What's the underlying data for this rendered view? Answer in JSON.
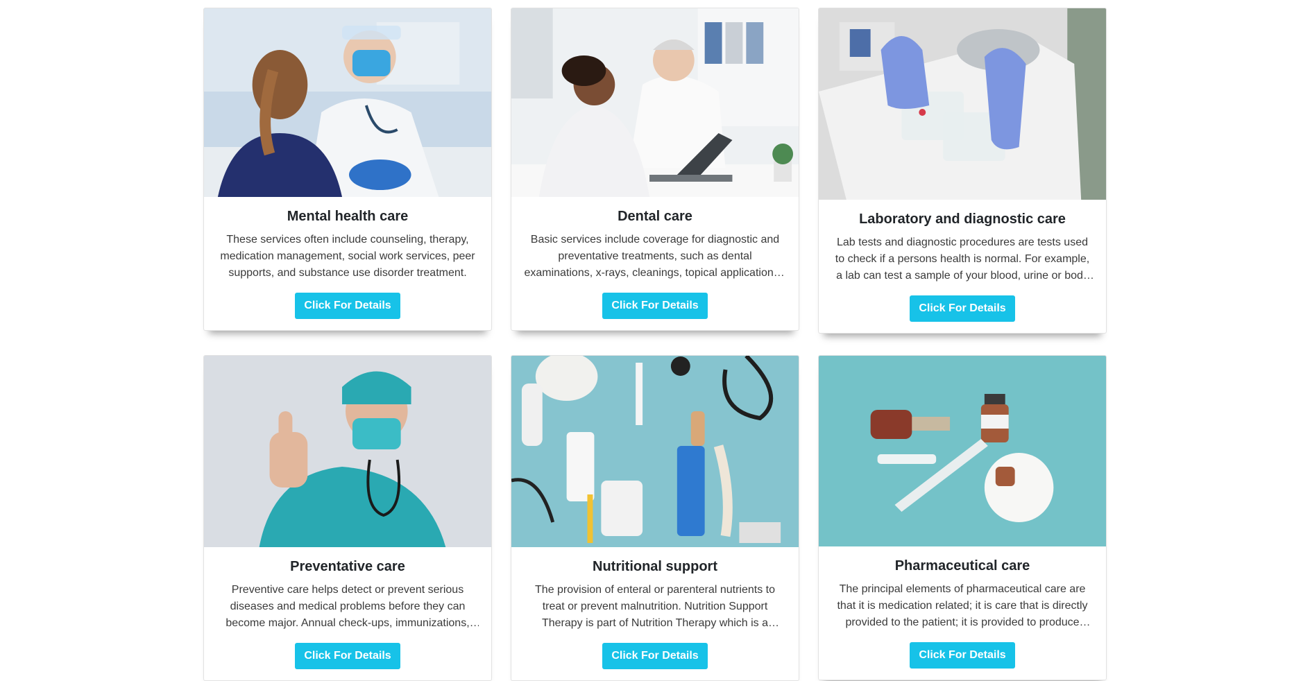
{
  "cards": [
    {
      "title": "Mental health care",
      "text": "These services often include counseling, therapy, medication management, social work services, peer supports, and substance use disorder treatment.",
      "button": "Click For Details",
      "image": "doctor-with-child-patient"
    },
    {
      "title": "Dental care",
      "text": "Basic services include coverage for diagnostic and preventative treatments, such as dental examinations, x-rays, cleanings, topical application of fluoride and more.",
      "button": "Click For Details",
      "image": "doctors-at-laptop"
    },
    {
      "title": "Laboratory and diagnostic care",
      "text": "Lab tests and diagnostic procedures are tests used to check if a persons health is normal. For example, a lab can test a sample of your blood, urine or body tissues.",
      "button": "Click For Details",
      "image": "gloved-hands-lab-samples"
    },
    {
      "title": "Preventative care",
      "text": "Preventive care helps detect or prevent serious diseases and medical problems before they can become major. Annual check-ups, immunizations, and flu shots.",
      "button": "Click For Details",
      "image": "surgeon-thumbs-up"
    },
    {
      "title": "Nutritional support",
      "text": "The provision of enteral or parenteral nutrients to treat or prevent malnutrition. Nutrition Support Therapy is part of Nutrition Therapy which is a component of care.",
      "button": "Click For Details",
      "image": "medical-supplies-flatlay"
    },
    {
      "title": "Pharmaceutical care",
      "text": "The principal elements of pharmaceutical care are that it is medication related; it is care that is directly provided to the patient; it is provided to produce outcomes.",
      "button": "Click For Details",
      "image": "vials-and-syringes"
    }
  ],
  "colors": {
    "button": "#17c2e8",
    "title": "#212529",
    "text": "#3a3a3a"
  }
}
